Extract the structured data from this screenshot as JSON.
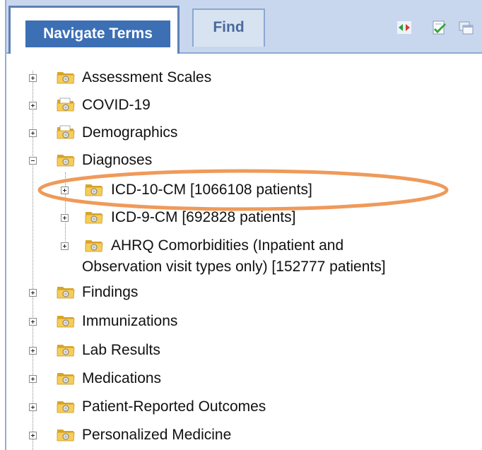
{
  "tabs": {
    "navigate_terms": "Navigate Terms",
    "find": "Find"
  },
  "toolbar": {
    "icons": [
      "swap-arrows-icon",
      "checklist-icon",
      "copy-window-icon"
    ]
  },
  "tree": {
    "items": [
      {
        "label": "Assessment Scales",
        "expanded": false
      },
      {
        "label": "COVID-19",
        "expanded": false
      },
      {
        "label": "Demographics",
        "expanded": false
      },
      {
        "label": "Diagnoses",
        "expanded": true,
        "children": [
          {
            "label": "ICD-10-CM [1066108 patients]",
            "expanded": false,
            "highlighted": true
          },
          {
            "label": "ICD-9-CM [692828 patients]",
            "expanded": false
          },
          {
            "label": "AHRQ Comorbidities (Inpatient and",
            "label_line2": "Observation visit types only) [152777 patients]",
            "expanded": false
          }
        ]
      },
      {
        "label": "Findings",
        "expanded": false
      },
      {
        "label": "Immunizations",
        "expanded": false
      },
      {
        "label": "Lab Results",
        "expanded": false
      },
      {
        "label": "Medications",
        "expanded": false
      },
      {
        "label": "Patient-Reported Outcomes",
        "expanded": false
      },
      {
        "label": "Personalized Medicine",
        "expanded": false
      }
    ]
  },
  "colors": {
    "highlight_ring": "#ef9a5a",
    "folder_fill": "#f5c84a",
    "tab_active": "#3c6fb4"
  }
}
